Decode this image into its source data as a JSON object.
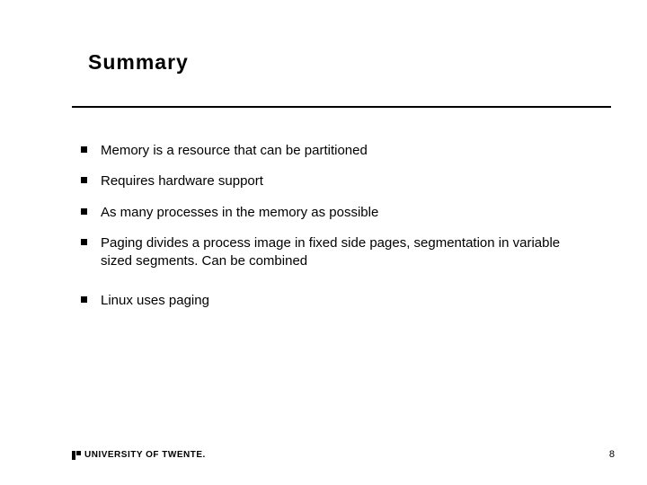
{
  "title": "Summary",
  "bullets": [
    "Memory is a resource that can be partitioned",
    "Requires hardware support",
    "As many processes in the memory as possible",
    "Paging divides a process image in fixed side pages, segmentation in variable sized segments. Can be combined",
    "Linux uses paging"
  ],
  "footer": "UNIVERSITY OF TWENTE.",
  "page_number": "8"
}
